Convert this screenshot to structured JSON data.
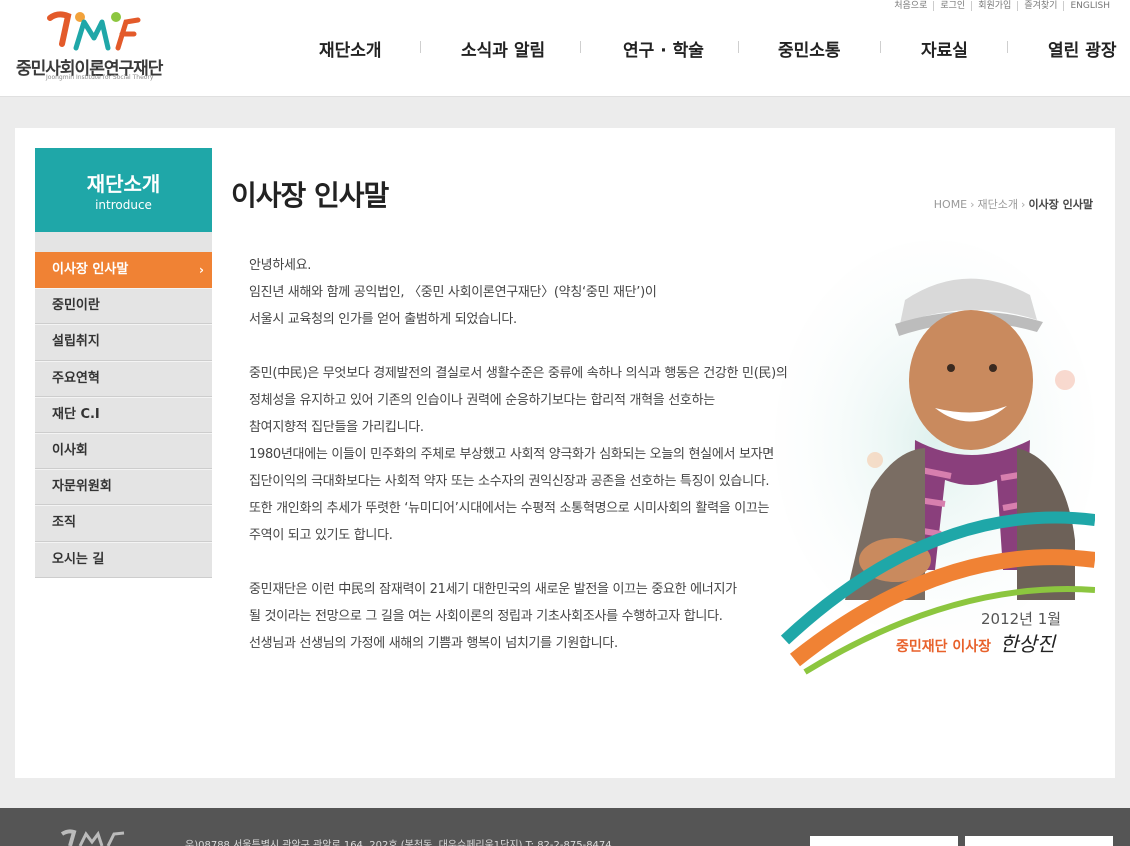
{
  "header": {
    "logo_name": "중민사회이론연구재단",
    "logo_sub": "Joongmin Institute for Social Theory",
    "util": [
      "처음으로",
      "로그인",
      "회원가입",
      "즐겨찾기",
      "ENGLISH"
    ],
    "gnb": [
      "재단소개",
      "소식과 알림",
      "연구 · 학술",
      "중민소통",
      "자료실",
      "열린 광장"
    ]
  },
  "sidebar": {
    "title": "재단소개",
    "subtitle": "introduce",
    "items": [
      {
        "label": "이사장 인사말",
        "active": true
      },
      {
        "label": "중민이란"
      },
      {
        "label": "설립취지"
      },
      {
        "label": "주요연혁"
      },
      {
        "label": "재단 C.I"
      },
      {
        "label": "이사회"
      },
      {
        "label": "자문위원회"
      },
      {
        "label": "조직"
      },
      {
        "label": "오시는 길"
      }
    ]
  },
  "main": {
    "title": "이사장 인사말",
    "breadcrumb": [
      "HOME",
      "재단소개",
      "이사장 인사말"
    ],
    "paragraphs": [
      [
        "안녕하세요.",
        "임진년 새해와 함께 공익법인, 〈중민 사회이론연구재단〉(약칭‘중민 재단’)이",
        "서울시 교육청의 인가를 얻어 출범하게 되었습니다."
      ],
      [
        "중민(中民)은 무엇보다 경제발전의 결실로서 생활수준은 중류에 속하나 의식과 행동은 건강한 민(民)의",
        "정체성을 유지하고 있어 기존의 인습이나 권력에 순응하기보다는 합리적 개혁을 선호하는",
        "참여지향적 집단들을 가리킵니다.",
        "1980년대에는 이들이 민주화의 주체로 부상했고 사회적 양극화가 심화되는 오늘의 현실에서 보자면",
        "집단이익의 극대화보다는 사회적 약자 또는 소수자의 권익신장과 공존을 선호하는 특징이 있습니다.",
        "또한 개인화의 추세가 뚜렷한 ‘뉴미디어’시대에서는 수평적 소통혁명으로 시미사회의 활력을 이끄는",
        "주역이 되고 있기도 합니다."
      ],
      [
        "중민재단은 이런 中民의 잠재력이 21세기 대한민국의 새로운 발전을 이끄는 중요한 에너지가",
        "될 것이라는 전망으로 그 길을 여는 사회이론의 정립과 기초사회조사를 수행하고자 합니다.",
        "선생님과 선생님의 가정에 새해의 기쁨과 행복이 넘치기를 기원합니다."
      ]
    ],
    "date": "2012년 1월",
    "signer": "중민재단 이사장",
    "signature": "한상진"
  },
  "footer": {
    "address": "우)08788  서울특별시 관악구 관악로 164, 202호 (봉천동, 대우슈페리움1단지)       T: 82-2-875-8474"
  },
  "colors": {
    "accent_teal": "#1fa7a8",
    "accent_orange": "#f08234"
  }
}
